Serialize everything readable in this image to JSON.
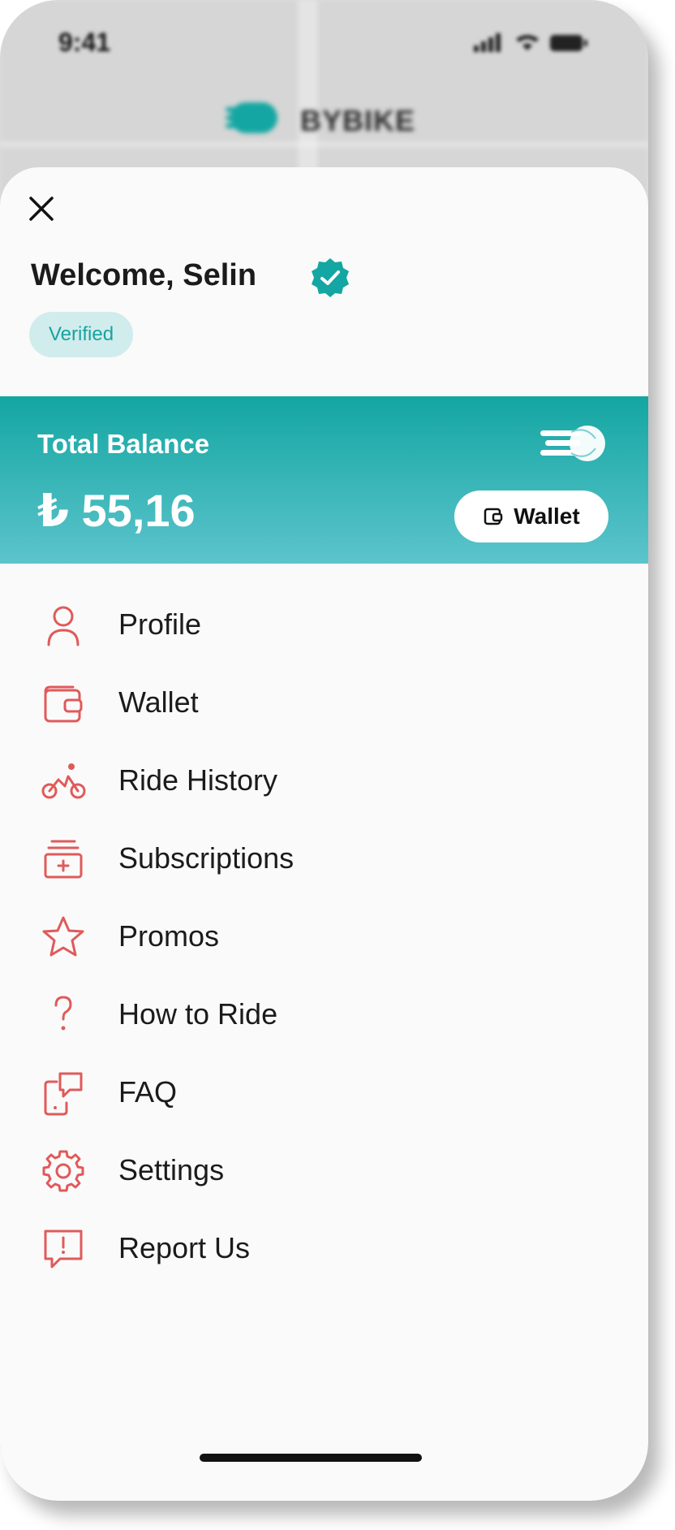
{
  "status_bar": {
    "time": "9:41"
  },
  "brand": {
    "name": "BYBIKE",
    "color": "#14a6a2"
  },
  "header": {
    "welcome": "Welcome, Selin",
    "badge": "Verified"
  },
  "balance": {
    "label": "Total Balance",
    "amount": "₺ 55,16",
    "wallet_button": "Wallet"
  },
  "menu": {
    "items": [
      {
        "label": "Profile",
        "icon": "user-icon"
      },
      {
        "label": "Wallet",
        "icon": "wallet-icon"
      },
      {
        "label": "Ride History",
        "icon": "bike-icon"
      },
      {
        "label": "Subscriptions",
        "icon": "subscriptions-icon"
      },
      {
        "label": "Promos",
        "icon": "star-icon"
      },
      {
        "label": "How to Ride",
        "icon": "question-icon"
      },
      {
        "label": "FAQ",
        "icon": "faq-icon"
      },
      {
        "label": "Settings",
        "icon": "gear-icon"
      },
      {
        "label": "Report Us",
        "icon": "report-icon"
      }
    ]
  },
  "colors": {
    "accent": "#14a6a2",
    "icon": "#e05a5a"
  }
}
